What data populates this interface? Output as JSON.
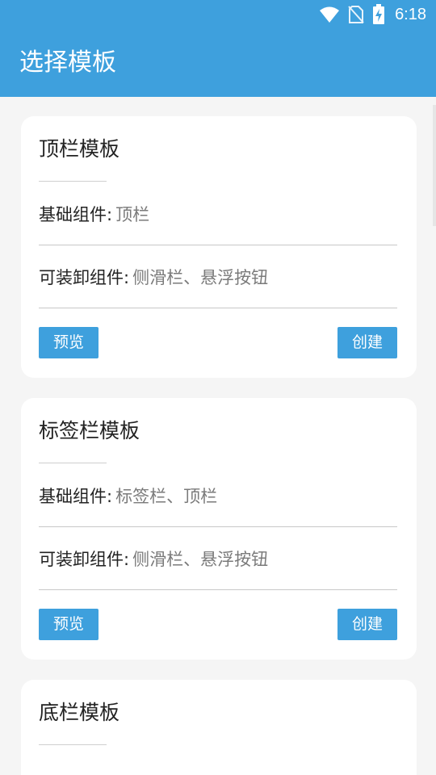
{
  "status_bar": {
    "time": "6:18",
    "icons": [
      "wifi-icon",
      "no-sim-icon",
      "battery-charging-icon"
    ]
  },
  "app_bar": {
    "title": "选择模板"
  },
  "colors": {
    "primary": "#3ea0dd",
    "card_bg": "#ffffff",
    "page_bg": "#f5f5f5"
  },
  "templates": [
    {
      "title": "顶栏模板",
      "base_label": "基础组件:",
      "base_value": "顶栏",
      "optional_label": "可装卸组件:",
      "optional_value": "侧滑栏、悬浮按钮",
      "preview_label": "预览",
      "create_label": "创建"
    },
    {
      "title": "标签栏模板",
      "base_label": "基础组件:",
      "base_value": "标签栏、顶栏",
      "optional_label": "可装卸组件:",
      "optional_value": "侧滑栏、悬浮按钮",
      "preview_label": "预览",
      "create_label": "创建"
    },
    {
      "title": "底栏模板"
    }
  ]
}
